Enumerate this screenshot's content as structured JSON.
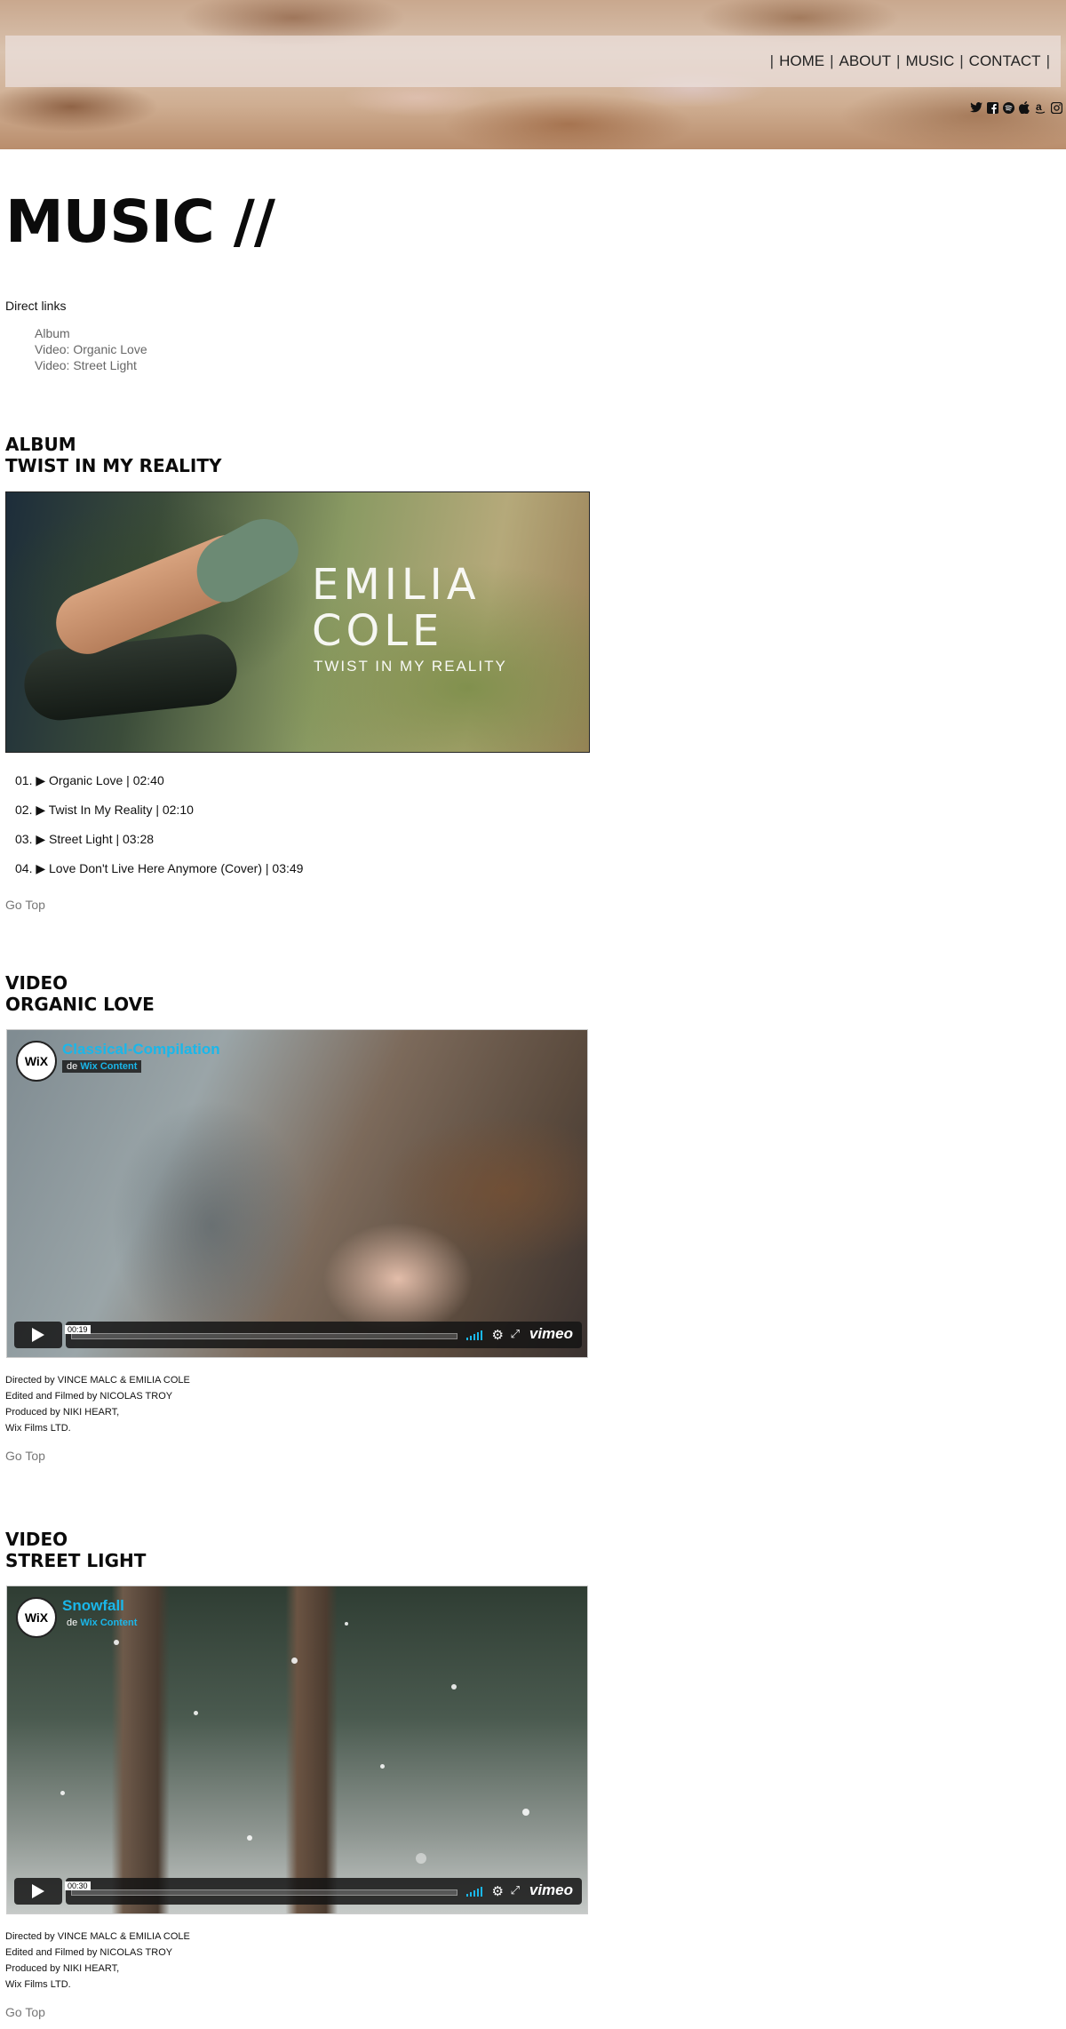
{
  "nav": {
    "items": [
      "HOME",
      "ABOUT",
      "MUSIC",
      "CONTACT"
    ],
    "separator": "|"
  },
  "social": {
    "icons": [
      "twitter-icon",
      "facebook-icon",
      "spotify-icon",
      "apple-icon",
      "amazon-icon",
      "instagram-icon"
    ]
  },
  "page": {
    "title": "MUSIC //"
  },
  "direct_links": {
    "label": "Direct links",
    "items": [
      "Album",
      "Video: Organic Love",
      "Video: Street Light"
    ]
  },
  "album": {
    "heading1": "ALBUM",
    "heading2": "TWIST IN MY REALITY",
    "cover_artist_line1": "EMILIA",
    "cover_artist_line2": "COLE",
    "cover_subtitle": "TWIST IN MY REALITY",
    "tracks": [
      "01. ▶ Organic Love | 02:40",
      "02. ▶ Twist In My Reality | 02:10",
      "03. ▶ Street Light | 03:28",
      "04. ▶ Love Don't Live Here Anymore (Cover) | 03:49"
    ],
    "go_top": "Go Top"
  },
  "video1": {
    "heading1": "VIDEO",
    "heading2": "ORGANIC LOVE",
    "badge": "WiX",
    "title": "Classical-Compilation",
    "by_prefix": "de",
    "by_name": "Wix Content",
    "time": "00:19",
    "logo": "vimeo",
    "credits": [
      "Directed by VINCE MALC & EMILIA COLE",
      "Edited and Filmed by NICOLAS TROY",
      "Produced by NIKI HEART,",
      "Wix Films LTD."
    ],
    "go_top": "Go Top"
  },
  "video2": {
    "heading1": "VIDEO",
    "heading2": "STREET LIGHT",
    "badge": "WiX",
    "title": "Snowfall",
    "by_prefix": "de",
    "by_name": "Wix Content",
    "time": "00:30",
    "logo": "vimeo",
    "credits": [
      "Directed by VINCE MALC & EMILIA COLE",
      "Edited and Filmed by NICOLAS TROY",
      "Produced by NIKI HEART,",
      "Wix Films LTD."
    ],
    "go_top": "Go Top"
  },
  "colors": {
    "accent": "#1ab7ea",
    "link_gray": "#777777"
  }
}
